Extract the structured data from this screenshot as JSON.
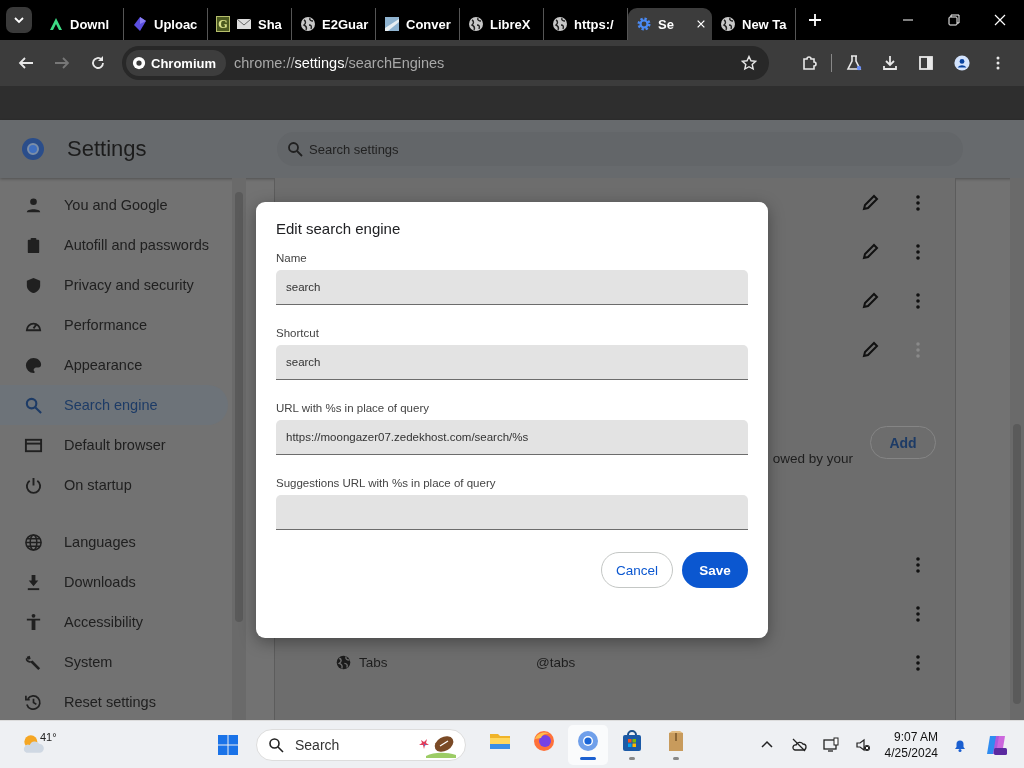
{
  "browser": {
    "tabs": [
      {
        "kind": "arrow",
        "title": "Downl",
        "selected": false
      },
      {
        "kind": "cube",
        "title": "Uploac",
        "selected": false
      },
      {
        "kind": "letter-mail",
        "title": "Sha",
        "selected": false
      },
      {
        "kind": "globe",
        "title": "E2Guar",
        "selected": false
      },
      {
        "kind": "image",
        "title": "Conver",
        "selected": false
      },
      {
        "kind": "globe",
        "title": "LibreX",
        "selected": false
      },
      {
        "kind": "globe",
        "title": "https:/",
        "selected": false
      },
      {
        "kind": "gear",
        "title": "Se",
        "selected": true
      },
      {
        "kind": "globe",
        "title": "New Ta",
        "selected": false
      }
    ],
    "tab_letter": "G",
    "forward_disabled": true,
    "site_chip": "Chromium",
    "url": "chrome://**settings**/searchEngines"
  },
  "settings": {
    "title": "Settings",
    "search": {
      "placeholder": "Search settings"
    },
    "sidebar": {
      "sections": [
        {
          "items": [
            {
              "kind": "person",
              "label": "You and Google",
              "selected": false
            },
            {
              "kind": "clipboard",
              "label": "Autofill and passwords",
              "selected": false
            },
            {
              "kind": "shield",
              "label": "Privacy and security",
              "selected": false
            },
            {
              "kind": "gauge",
              "label": "Performance",
              "selected": false
            },
            {
              "kind": "palette",
              "label": "Appearance",
              "selected": false
            },
            {
              "kind": "search",
              "label": "Search engine",
              "selected": true
            },
            {
              "kind": "browser",
              "label": "Default browser",
              "selected": false
            },
            {
              "kind": "power",
              "label": "On startup",
              "selected": false
            }
          ]
        },
        {
          "items": [
            {
              "kind": "globe",
              "label": "Languages",
              "selected": false
            },
            {
              "kind": "download",
              "label": "Downloads",
              "selected": false
            },
            {
              "kind": "accessibility",
              "label": "Accessibility",
              "selected": false
            },
            {
              "kind": "wrench",
              "label": "System",
              "selected": false
            },
            {
              "kind": "history",
              "label": "Reset settings",
              "selected": false
            }
          ]
        }
      ]
    },
    "top_rows": [
      {
        "menu_disabled": false
      },
      {
        "menu_disabled": false
      },
      {
        "menu_disabled": false
      },
      {
        "menu_disabled": true
      }
    ],
    "add_button": "Add",
    "note": "owed by your",
    "bottom_rows": [
      {
        "menu_disabled": false
      },
      {
        "menu_disabled": false
      },
      {
        "name": "Tabs",
        "shortcut": "@tabs",
        "menu_disabled": false
      }
    ]
  },
  "dialog": {
    "title": "Edit search engine",
    "fields": [
      {
        "label": "Name",
        "value": "search"
      },
      {
        "label": "Shortcut",
        "value": "search"
      },
      {
        "label": "URL with %s in place of query",
        "value": "https://moongazer07.zedekhost.com/search/%s"
      },
      {
        "label": "Suggestions URL with %s in place of query"
      }
    ],
    "buttons": [
      {
        "kind": "secondary",
        "label": "Cancel"
      },
      {
        "kind": "primary",
        "label": "Save"
      }
    ]
  },
  "taskbar": {
    "temperature": "41°",
    "search": {
      "placeholder": "Search"
    },
    "apps": [
      {
        "kind": "folder",
        "selected": false,
        "running": false
      },
      {
        "kind": "firefox",
        "selected": false,
        "running": false
      },
      {
        "kind": "chromium",
        "selected": true,
        "running": true
      },
      {
        "kind": "store",
        "selected": false,
        "running": true
      },
      {
        "kind": "box",
        "selected": false,
        "running": true
      }
    ],
    "time": "9:07 AM",
    "date": "4/25/2024"
  }
}
